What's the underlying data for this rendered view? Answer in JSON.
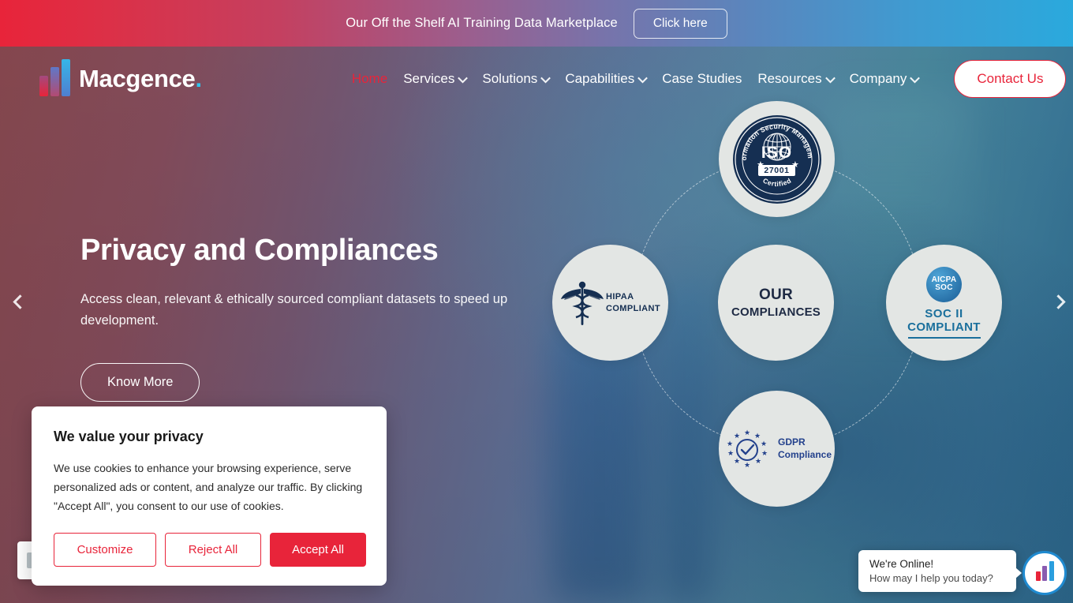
{
  "announcement": {
    "text": "Our Off the Shelf AI Training Data Marketplace",
    "button_label": "Click here"
  },
  "brand": {
    "name": "Macgence",
    "dot": ".",
    "accent_color": "#e8243a",
    "cyan_color": "#2ec5f0"
  },
  "nav": {
    "items": [
      {
        "label": "Home",
        "has_dropdown": false,
        "active": true
      },
      {
        "label": "Services",
        "has_dropdown": true,
        "active": false
      },
      {
        "label": "Solutions",
        "has_dropdown": true,
        "active": false
      },
      {
        "label": "Capabilities",
        "has_dropdown": true,
        "active": false
      },
      {
        "label": "Case Studies",
        "has_dropdown": false,
        "active": false
      },
      {
        "label": "Resources",
        "has_dropdown": true,
        "active": false
      },
      {
        "label": "Company",
        "has_dropdown": true,
        "active": false
      }
    ],
    "contact_label": "Contact Us"
  },
  "hero": {
    "title": "Privacy and Compliances",
    "subtitle": "Access clean, relevant & ethically sourced compliant datasets to speed up development.",
    "cta_label": "Know More"
  },
  "compliance": {
    "center_line1": "OUR",
    "center_line2": "COMPLIANCES",
    "iso": {
      "curve_top": "Information Security Management",
      "word": "ISO",
      "number": "27001",
      "curve_bottom": "Certified"
    },
    "hipaa": {
      "line1": "HIPAA",
      "line2": "COMPLIANT"
    },
    "soc": {
      "logo_line1": "AICPA",
      "logo_line2": "SOC",
      "line1": "SOC II",
      "line2": "COMPLIANT"
    },
    "gdpr": {
      "line1": "GDPR",
      "line2": "Compliance"
    }
  },
  "cookie": {
    "title": "We value your privacy",
    "body": "We use cookies to enhance your browsing experience, serve personalized ads or content, and analyze our traffic. By clicking \"Accept All\", you consent to our use of cookies.",
    "customize_label": "Customize",
    "reject_label": "Reject All",
    "accept_label": "Accept All"
  },
  "chat": {
    "status": "We're Online!",
    "prompt": "How may I help you today?"
  }
}
